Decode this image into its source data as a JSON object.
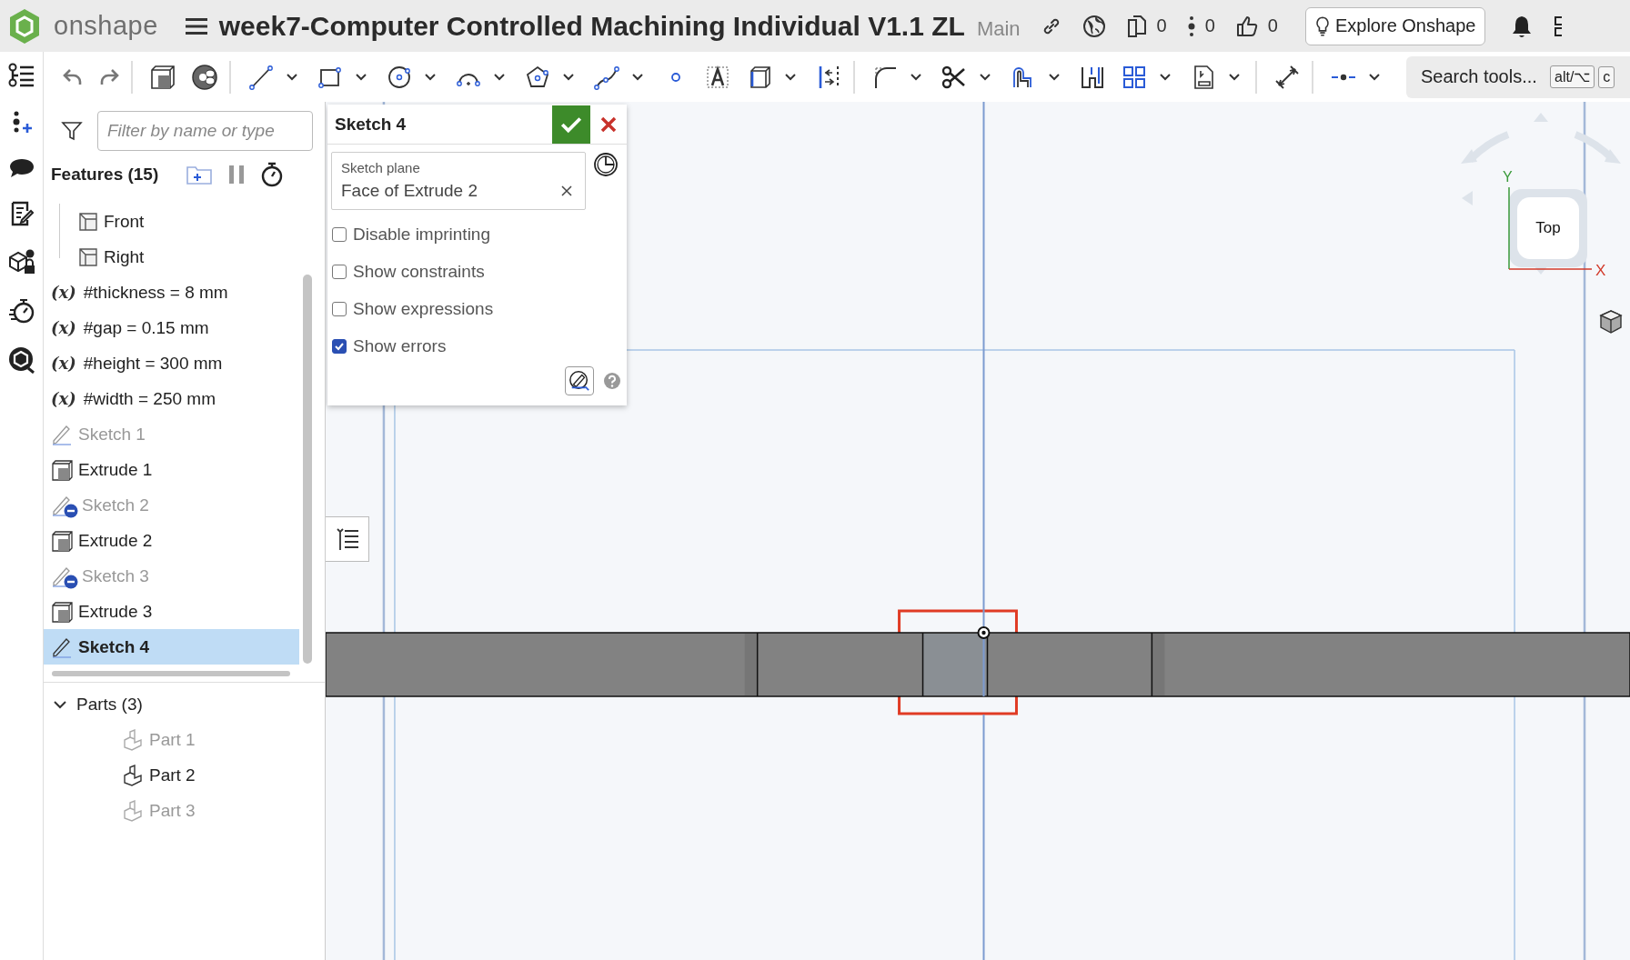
{
  "top_bar": {
    "logo": "onshape",
    "document_title": "week7-Computer Controlled Machining Individual V1.1 ZL",
    "branch": "Main",
    "counters": [
      {
        "kind": "copies",
        "value": "0"
      },
      {
        "kind": "versions",
        "value": "0"
      },
      {
        "kind": "likes",
        "value": "0"
      }
    ],
    "explore_button": "Explore Onshape"
  },
  "toolbar": {
    "search": {
      "placeholder": "Search tools..."
    },
    "shortcut_keys": [
      "alt/⌥",
      "c"
    ]
  },
  "feature_panel": {
    "filter": {
      "placeholder": "Filter by name or type"
    },
    "header": "Features (15)",
    "features": [
      {
        "kind": "plane",
        "label": "Front",
        "dimmed": false,
        "selected": false
      },
      {
        "kind": "plane",
        "label": "Right",
        "dimmed": false,
        "selected": false
      },
      {
        "kind": "variable",
        "symbol": "(x)",
        "label": "#thickness = 8 mm",
        "dimmed": false,
        "selected": false
      },
      {
        "kind": "variable",
        "symbol": "(x)",
        "label": "#gap = 0.15 mm",
        "dimmed": false,
        "selected": false
      },
      {
        "kind": "variable",
        "symbol": "(x)",
        "label": "#height = 300 mm",
        "dimmed": false,
        "selected": false
      },
      {
        "kind": "variable",
        "symbol": "(x)",
        "label": "#width = 250 mm",
        "dimmed": false,
        "selected": false
      },
      {
        "kind": "sketch",
        "label": "Sketch 1",
        "dimmed": true,
        "hidden_badge": false,
        "selected": false
      },
      {
        "kind": "extrude",
        "label": "Extrude 1",
        "dimmed": false,
        "selected": false
      },
      {
        "kind": "sketch",
        "label": "Sketch 2",
        "dimmed": true,
        "hidden_badge": true,
        "selected": false
      },
      {
        "kind": "extrude",
        "label": "Extrude 2",
        "dimmed": false,
        "selected": false
      },
      {
        "kind": "sketch",
        "label": "Sketch 3",
        "dimmed": true,
        "hidden_badge": true,
        "selected": false
      },
      {
        "kind": "extrude",
        "label": "Extrude 3",
        "dimmed": false,
        "selected": false
      },
      {
        "kind": "sketch",
        "label": "Sketch 4",
        "dimmed": false,
        "hidden_badge": false,
        "selected": true
      }
    ],
    "parts": {
      "header": "Parts (3)",
      "expanded": true,
      "items": [
        {
          "label": "Part 1",
          "dimmed": true
        },
        {
          "label": "Part 2",
          "dimmed": false
        },
        {
          "label": "Part 3",
          "dimmed": true
        }
      ]
    }
  },
  "sketch_dialog": {
    "title": "Sketch 4",
    "plane_field": {
      "label": "Sketch plane",
      "value": "Face of Extrude 2"
    },
    "options": [
      {
        "label": "Disable imprinting",
        "checked": false
      },
      {
        "label": "Show constraints",
        "checked": false
      },
      {
        "label": "Show expressions",
        "checked": false
      },
      {
        "label": "Show errors",
        "checked": true
      }
    ]
  },
  "view_cube": {
    "face": "Top",
    "x_axis": "X",
    "y_axis": "Y"
  }
}
